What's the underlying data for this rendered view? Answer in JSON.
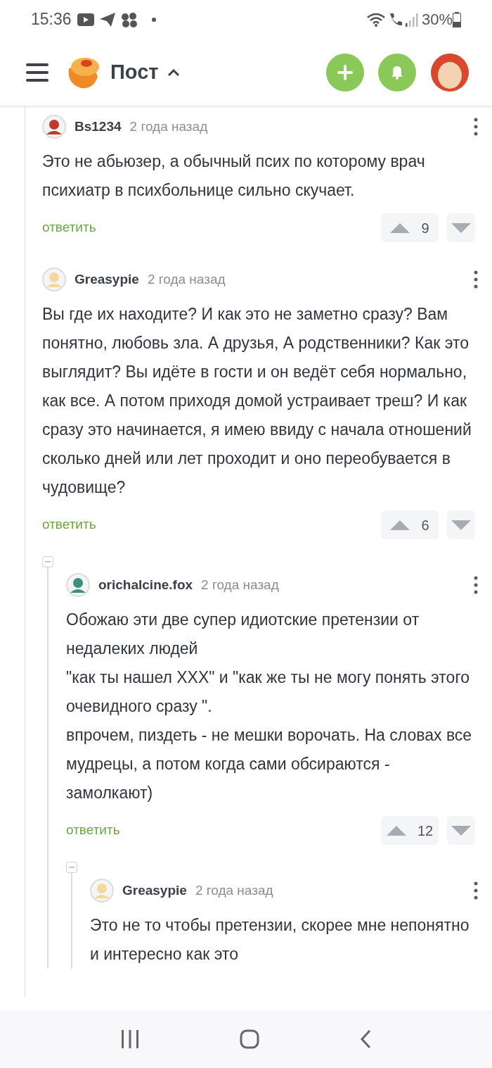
{
  "status_bar": {
    "time": "15:36",
    "battery": "30%"
  },
  "header": {
    "title": "Пост"
  },
  "comments": [
    {
      "author": "Bs1234",
      "time": "2 года назад",
      "text": "Это не абьюзер, а обычный псих по которому врач психиатр в психбольнице сильно скучает.",
      "reply": "ответить",
      "votes": "9"
    },
    {
      "author": "Greasypie",
      "time": "2 года назад",
      "text": "Вы где их находите? И как это не заметно сразу? Вам понятно, любовь зла. А друзья, А родственники? Как это выглядит? Вы идёте в гости и он ведёт себя нормально, как все. А потом приходя домой устраивает треш? И как сразу это начинается, я имею ввиду с начала отношений сколько дней или лет проходит и оно переобувается в чудовище?",
      "reply": "ответить",
      "votes": "6",
      "children": [
        {
          "author": "orichalcine.fox",
          "time": "2 года назад",
          "text": "Обожаю эти две супер идиотские претензии от недалеких людей\n\"как ты нашел ХХХ\" и \"как же ты не могу понять этого очевидного сразу \".\nвпрочем, пиздеть - не мешки ворочать. На словах все мудрецы, а потом когда сами обсираются - замолкают)",
          "reply": "ответить",
          "votes": "12",
          "children": [
            {
              "author": "Greasypie",
              "time": "2 года назад",
              "text": "Это не то чтобы претензии, скорее мне непонятно и интересно как это"
            }
          ]
        }
      ]
    }
  ]
}
